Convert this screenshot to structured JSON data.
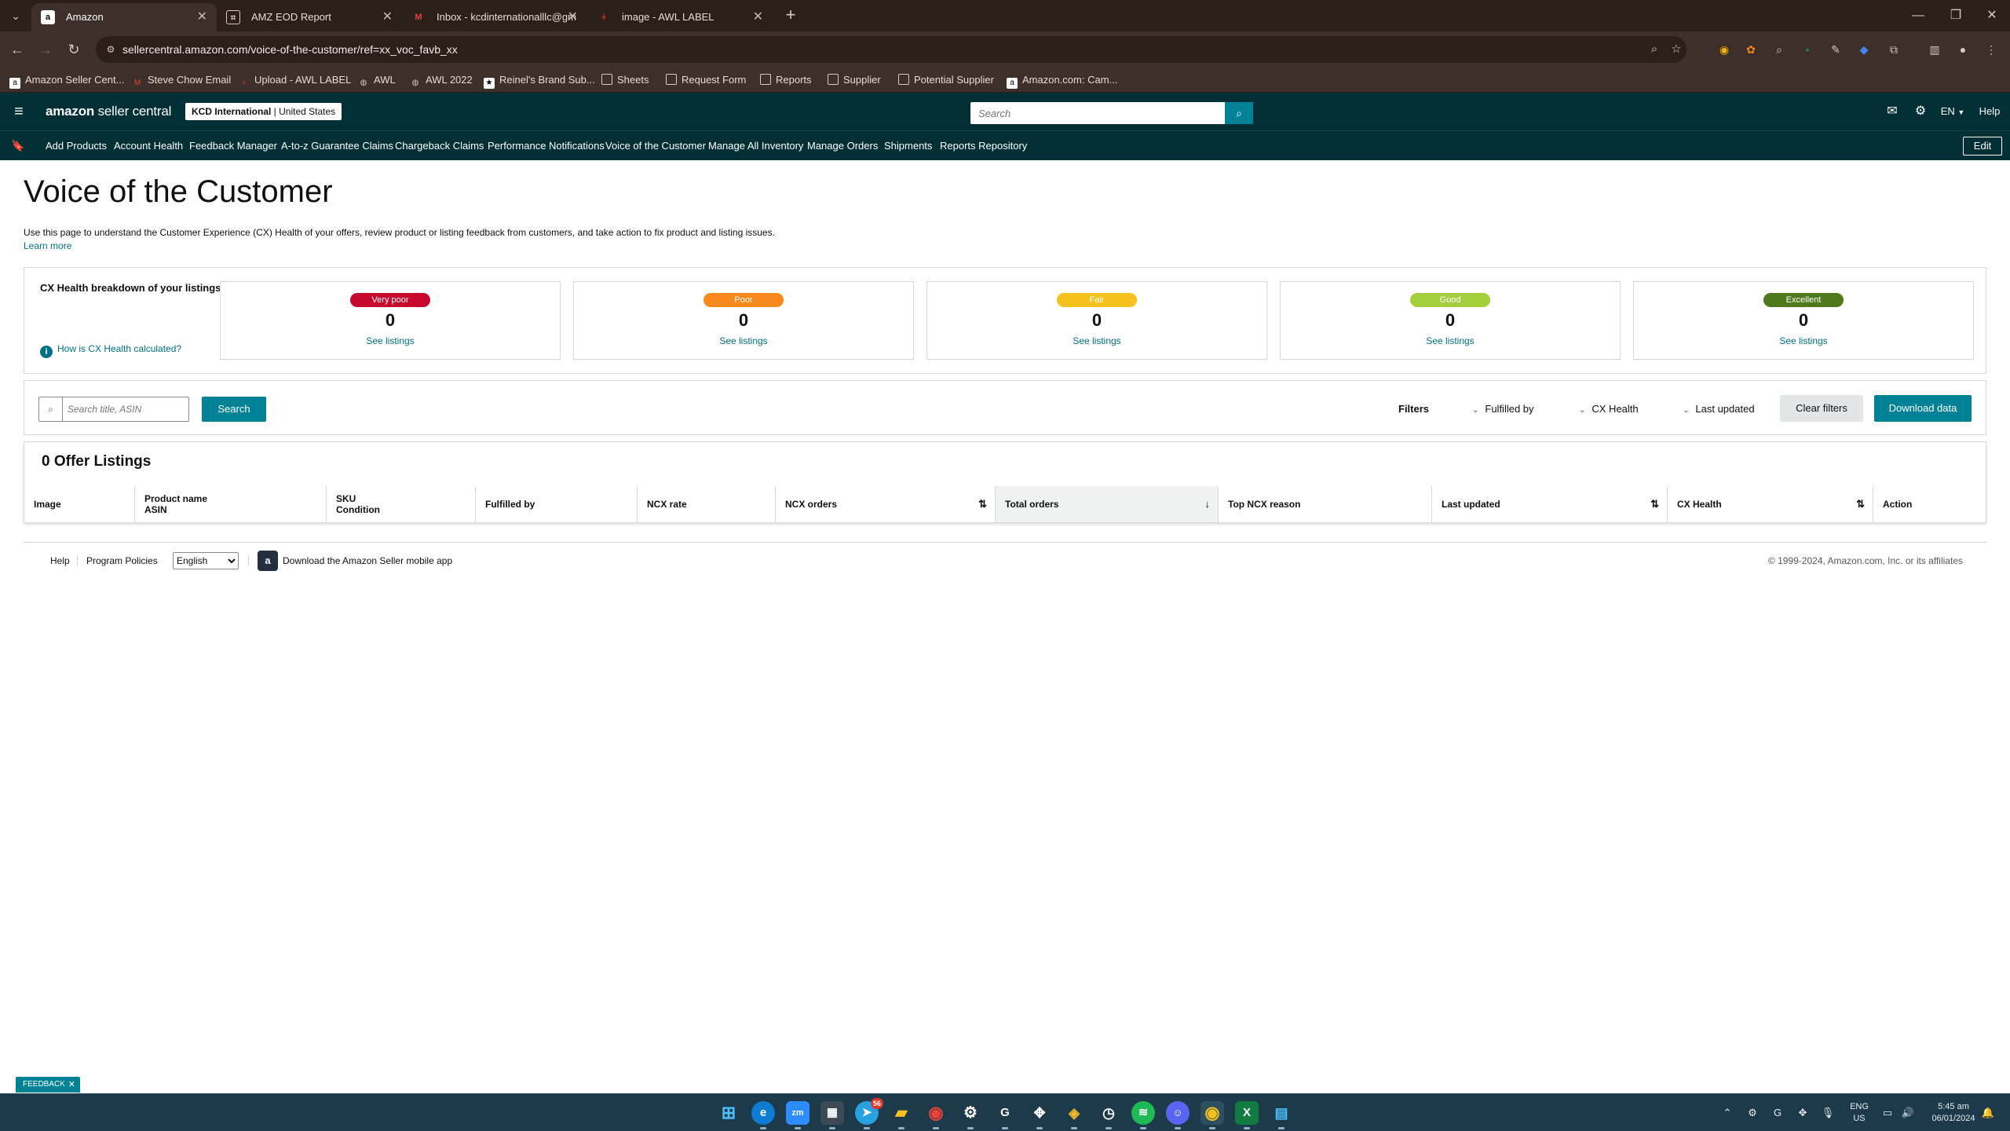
{
  "browser": {
    "tabs": [
      {
        "title": "Amazon",
        "favicon": "amazon-icon",
        "active": true
      },
      {
        "title": "AMZ EOD Report",
        "favicon": "sheets-icon",
        "active": false
      },
      {
        "title": "Inbox - kcdinternationalllc@gm",
        "favicon": "gmail-icon",
        "active": false
      },
      {
        "title": "image - AWL LABEL",
        "favicon": "awl-icon",
        "active": false
      }
    ],
    "url": "sellercentral.amazon.com/voice-of-the-customer/ref=xx_voc_favb_xx",
    "bookmarks": [
      "Amazon Seller Cent...",
      "Steve Chow Email",
      "Upload - AWL LABEL",
      "AWL",
      "AWL 2022",
      "Reinel's Brand Sub...",
      "Sheets",
      "Request Form",
      "Reports",
      "Supplier",
      "Potential Supplier",
      "Amazon.com: Cam..."
    ]
  },
  "header": {
    "logo_bold": "amazon",
    "logo_light": " seller central",
    "account_name": "KCD International",
    "account_region": " | United States",
    "search_placeholder": "Search",
    "language": "EN",
    "help": "Help"
  },
  "nav": {
    "items": [
      "Add Products",
      "Account Health",
      "Feedback Manager",
      "A-to-z Guarantee Claims",
      "Chargeback Claims",
      "Performance Notifications",
      "Voice of the Customer",
      "Manage All Inventory",
      "Manage Orders",
      "Shipments",
      "Reports Repository"
    ],
    "edit": "Edit"
  },
  "page": {
    "title": "Voice of the Customer",
    "description": "Use this page to understand the Customer Experience (CX) Health of your offers, review product or listing feedback from customers, and take action to fix product and listing issues.",
    "learn_more": "Learn more"
  },
  "cx_health": {
    "title": "CX Health breakdown of your listings",
    "how_link": "How is CX Health calculated?",
    "cards": [
      {
        "label": "Very poor",
        "count": "0",
        "link": "See listings",
        "color": "#c7092e"
      },
      {
        "label": "Poor",
        "count": "0",
        "link": "See listings",
        "color": "#f7891d"
      },
      {
        "label": "Fair",
        "count": "0",
        "link": "See listings",
        "color": "#f7c11d"
      },
      {
        "label": "Good",
        "count": "0",
        "link": "See listings",
        "color": "#a4cf3c"
      },
      {
        "label": "Excellent",
        "count": "0",
        "link": "See listings",
        "color": "#4e7a1b"
      }
    ]
  },
  "filters": {
    "search_placeholder": "Search title, ASIN",
    "search_button": "Search",
    "label": "Filters",
    "dropdowns": [
      "Fulfilled by",
      "CX Health",
      "Last updated"
    ],
    "clear": "Clear filters",
    "download": "Download data"
  },
  "table": {
    "title": "0 Offer Listings",
    "columns": [
      {
        "label": "Image",
        "sub": ""
      },
      {
        "label": "Product name",
        "sub": "ASIN"
      },
      {
        "label": "SKU",
        "sub": "Condition"
      },
      {
        "label": "Fulfilled by",
        "sub": ""
      },
      {
        "label": "NCX rate",
        "sub": ""
      },
      {
        "label": "NCX orders",
        "sub": ""
      },
      {
        "label": "Total orders",
        "sub": ""
      },
      {
        "label": "Top NCX reason",
        "sub": ""
      },
      {
        "label": "Last updated",
        "sub": ""
      },
      {
        "label": "CX Health",
        "sub": ""
      },
      {
        "label": "Action",
        "sub": ""
      }
    ],
    "rows": []
  },
  "footer": {
    "help": "Help",
    "program_policies": "Program Policies",
    "language_selected": "English",
    "app_link": "Download the Amazon Seller mobile app",
    "copyright": "© 1999-2024, Amazon.com, Inc. or its affiliates"
  },
  "feedback_tab": "FEEDBACK",
  "taskbar": {
    "telegram_badge": "56",
    "lang_line1": "ENG",
    "lang_line2": "US",
    "time": "5:45 am",
    "date": "06/01/2024"
  }
}
